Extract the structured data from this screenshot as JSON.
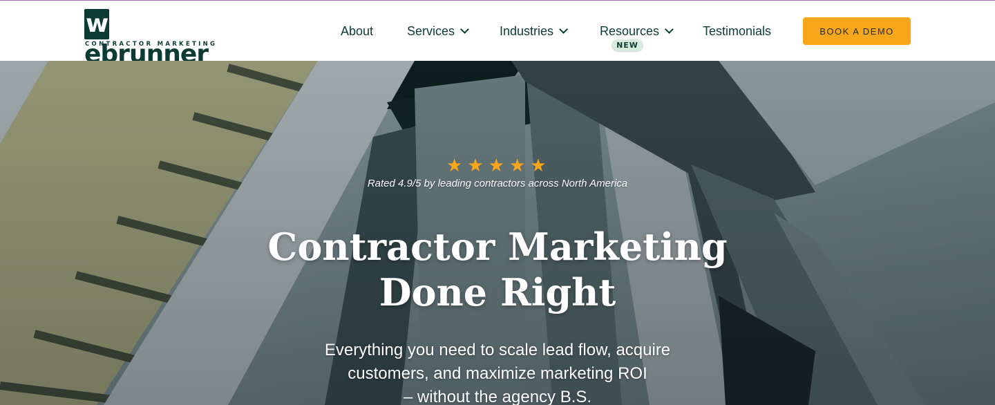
{
  "brand": {
    "logo_initial": "w",
    "logo_rest": "ebrunner",
    "tagline": "CONTRACTOR MARKETING"
  },
  "nav": {
    "items": [
      {
        "label": "About",
        "has_dropdown": false
      },
      {
        "label": "Services",
        "has_dropdown": true
      },
      {
        "label": "Industries",
        "has_dropdown": true
      },
      {
        "label": "Resources",
        "has_dropdown": true,
        "badge": "NEW"
      },
      {
        "label": "Testimonials",
        "has_dropdown": false
      }
    ],
    "cta_label": "BOOK A DEMO"
  },
  "hero": {
    "rating_stars": 5,
    "rating_text": "Rated 4.9/5 by leading contractors across North America",
    "title_line1": "Contractor Marketing",
    "title_line2": "Done Right",
    "subtitle_line1": "Everything you need to scale lead flow, acquire",
    "subtitle_line2": "customers, and maximize marketing ROI",
    "subtitle_line3": "– without the agency B.S."
  },
  "colors": {
    "brand_dark": "#0c3b33",
    "accent": "#f9a61b",
    "badge_bg": "#d7ecdf"
  },
  "icons": [
    "chevron-down-icon",
    "star-icon"
  ]
}
